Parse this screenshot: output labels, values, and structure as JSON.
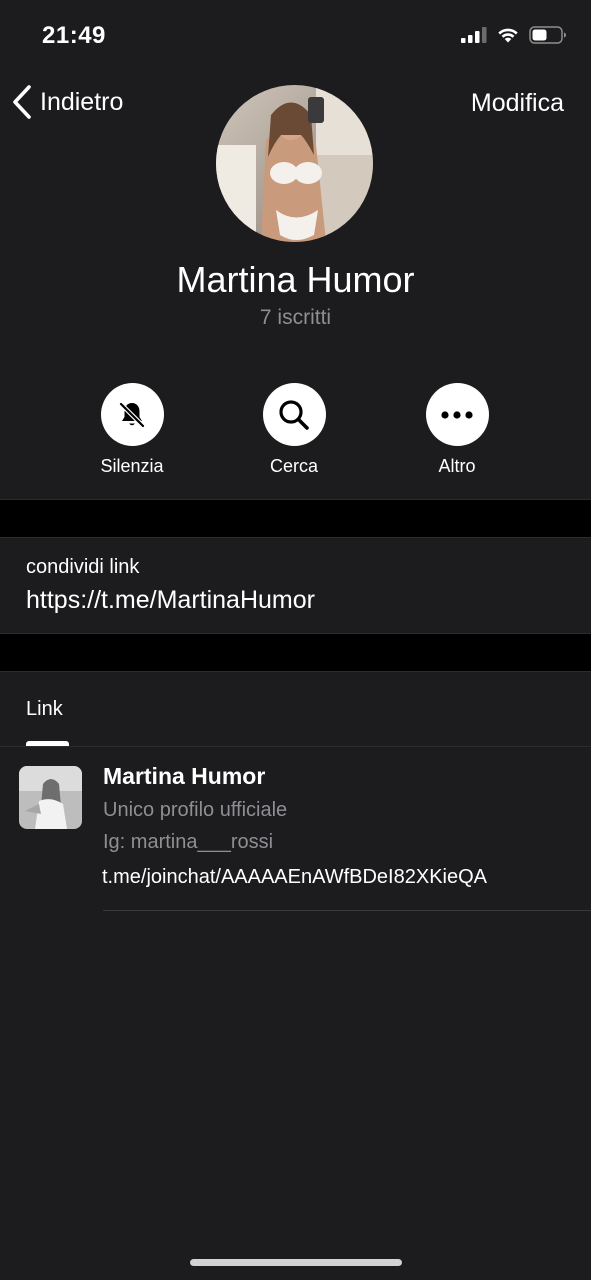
{
  "status_bar": {
    "time": "21:49"
  },
  "nav": {
    "back_label": "Indietro",
    "edit_label": "Modifica"
  },
  "channel": {
    "name": "Martina Humor",
    "subscribers": "7 iscritti"
  },
  "actions": [
    {
      "label": "Silenzia",
      "icon": "bell-slash-icon"
    },
    {
      "label": "Cerca",
      "icon": "search-icon"
    },
    {
      "label": "Altro",
      "icon": "more-icon"
    }
  ],
  "share": {
    "title": "condividi link",
    "url": "https://t.me/MartinaHumor"
  },
  "tabs": {
    "active": "Link"
  },
  "link_item": {
    "title": "Martina Humor",
    "desc1": "Unico profilo ufficiale",
    "desc2": "Ig: martina___rossi",
    "url": "t.me/joinchat/AAAAAEnAWfBDeI82XKieQA"
  },
  "colors": {
    "background": "#1c1c1e",
    "secondary_text": "#8e8e93",
    "band": "#000000"
  }
}
